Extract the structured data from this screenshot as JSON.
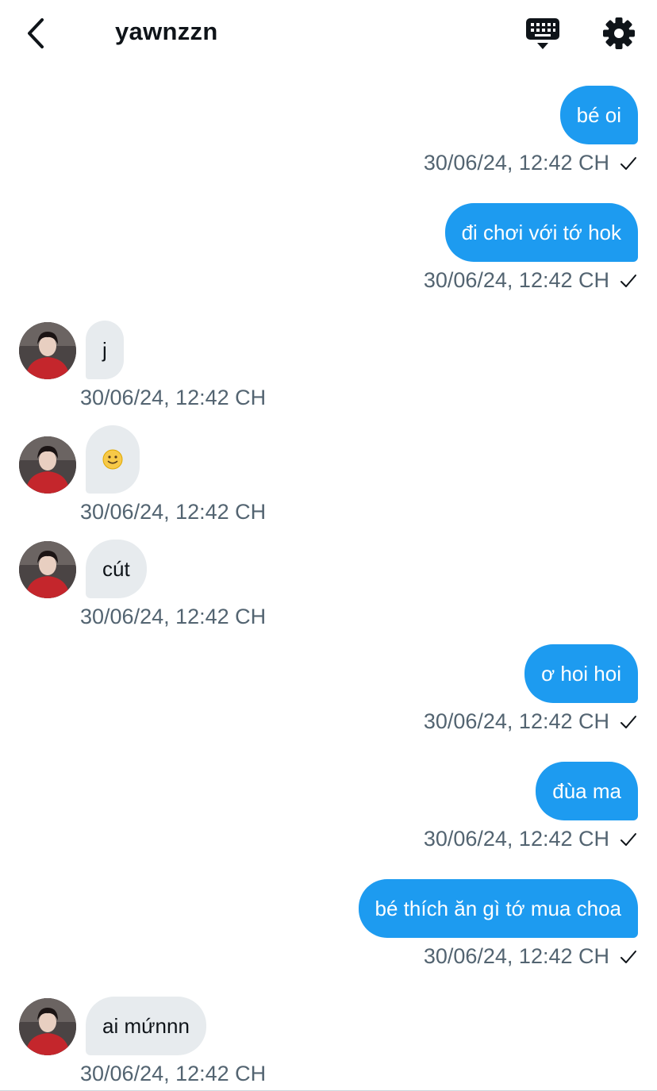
{
  "header": {
    "title": "yawnzzn",
    "back_icon": "chevron-left-icon",
    "keyboard_icon": "keyboard-icon",
    "settings_icon": "gear-icon"
  },
  "colors": {
    "outgoing_bubble": "#1d9bf0",
    "incoming_bubble": "#e7ebee",
    "timestamp": "#536471"
  },
  "messages": [
    {
      "direction": "out",
      "text": "bé oi",
      "time": "30/06/24, 12:42 CH",
      "status": "sent"
    },
    {
      "direction": "out",
      "text": "đi chơi với tớ hok",
      "time": "30/06/24, 12:42 CH",
      "status": "sent"
    },
    {
      "direction": "in",
      "text": "j",
      "time": "30/06/24, 12:42 CH"
    },
    {
      "direction": "in",
      "text": "🙂",
      "emoji": "slightly-smiling-face-icon",
      "time": "30/06/24, 12:42 CH"
    },
    {
      "direction": "in",
      "text": "cút",
      "time": "30/06/24, 12:42 CH"
    },
    {
      "direction": "out",
      "text": "ơ hoi hoi",
      "time": "30/06/24, 12:42 CH",
      "status": "sent"
    },
    {
      "direction": "out",
      "text": "đùa ma",
      "time": "30/06/24, 12:42 CH",
      "status": "sent"
    },
    {
      "direction": "out",
      "text": "bé thích ăn gì tớ mua choa",
      "time": "30/06/24, 12:42 CH",
      "status": "sent"
    },
    {
      "direction": "in",
      "text": "ai mứnnn",
      "time": "30/06/24, 12:42 CH"
    }
  ]
}
